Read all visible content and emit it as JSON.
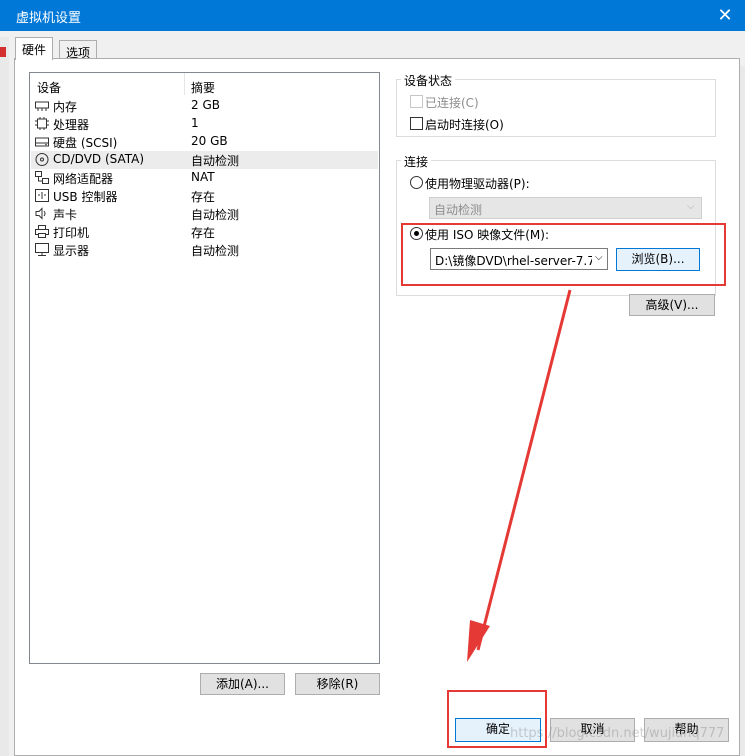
{
  "window": {
    "title": "虚拟机设置",
    "close_glyph": "✕"
  },
  "tabs": [
    {
      "label": "硬件"
    },
    {
      "label": "选项"
    }
  ],
  "device_table": {
    "headers": [
      "设备",
      "摘要"
    ],
    "rows": [
      {
        "name": "内存",
        "summary": "2 GB",
        "icon": "memory-icon"
      },
      {
        "name": "处理器",
        "summary": "1",
        "icon": "processor-icon"
      },
      {
        "name": "硬盘 (SCSI)",
        "summary": "20 GB",
        "icon": "harddisk-icon"
      },
      {
        "name": "CD/DVD (SATA)",
        "summary": "自动检测",
        "icon": "cd-dvd-icon",
        "selected": true
      },
      {
        "name": "网络适配器",
        "summary": "NAT",
        "icon": "network-adapter-icon"
      },
      {
        "name": "USB 控制器",
        "summary": "存在",
        "icon": "usb-icon"
      },
      {
        "name": "声卡",
        "summary": "自动检测",
        "icon": "speaker-icon"
      },
      {
        "name": "打印机",
        "summary": "存在",
        "icon": "printer-icon"
      },
      {
        "name": "显示器",
        "summary": "自动检测",
        "icon": "monitor-icon"
      }
    ],
    "add_button": "添加(A)...",
    "remove_button": "移除(R)"
  },
  "device_status": {
    "title": "设备状态",
    "connected": "已连接(C)",
    "connect_on_power_on": "启动时连接(O)"
  },
  "connection": {
    "title": "连接",
    "physical_drive": "使用物理驱动器(P):",
    "physical_drive_value": "自动检测",
    "iso_image": "使用 ISO 映像文件(M):",
    "iso_path": "D:\\镜像DVD\\rhel-server-7.7-",
    "browse_button": "浏览(B)...",
    "advanced_button": "高级(V)..."
  },
  "footer": {
    "ok_button": "确定",
    "cancel_button": "取消",
    "help_button": "帮助",
    "watermark": "https://blog.csdn.net/wujianq777"
  },
  "annotation_color": "#e53935",
  "accent_color": "#0078d7"
}
